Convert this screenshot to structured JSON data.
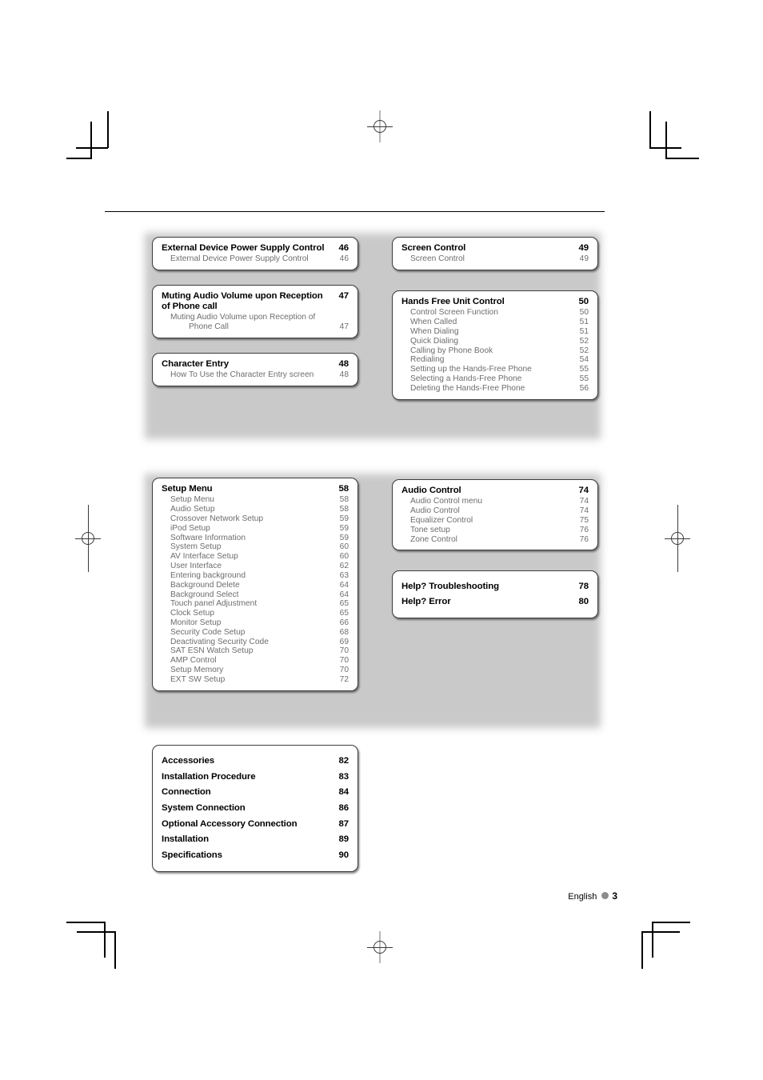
{
  "document": {
    "footer": {
      "language": "English",
      "page_number": "3"
    }
  },
  "groups": [
    {
      "id": "group-1",
      "columns": [
        {
          "id": "col-left-1",
          "boxes": [
            {
              "id": "external-device-power-supply-control",
              "title": "External Device Power Supply Control",
              "page": "46",
              "two_line_title": true,
              "items": [
                {
                  "label": "External Device Power Supply Control",
                  "page": "46"
                }
              ]
            },
            {
              "id": "muting-audio-volume",
              "title": "Muting Audio Volume upon Reception of Phone call",
              "page": "47",
              "two_line_title": true,
              "items": [
                {
                  "label": "Muting Audio Volume upon Reception of",
                  "continuation": "Phone Call",
                  "page": "47"
                }
              ]
            },
            {
              "id": "character-entry",
              "title": "Character Entry",
              "page": "48",
              "two_line_title": false,
              "items": [
                {
                  "label": "How To Use the Character Entry screen",
                  "page": "48"
                }
              ]
            }
          ]
        },
        {
          "id": "col-right-1",
          "boxes": [
            {
              "id": "screen-control",
              "title": "Screen Control",
              "page": "49",
              "two_line_title": false,
              "items": [
                {
                  "label": "Screen Control",
                  "page": "49"
                }
              ]
            },
            {
              "id": "hands-free-unit-control",
              "title": "Hands Free Unit Control",
              "page": "50",
              "two_line_title": false,
              "items": [
                {
                  "label": "Control Screen Function",
                  "page": "50"
                },
                {
                  "label": "When Called",
                  "page": "51"
                },
                {
                  "label": "When Dialing",
                  "page": "51"
                },
                {
                  "label": "Quick Dialing",
                  "page": "52"
                },
                {
                  "label": "Calling by Phone Book",
                  "page": "52"
                },
                {
                  "label": "Redialing",
                  "page": "54"
                },
                {
                  "label": "Setting up the Hands-Free Phone",
                  "page": "55"
                },
                {
                  "label": "Selecting a Hands-Free Phone",
                  "page": "55"
                },
                {
                  "label": "Deleting the Hands-Free Phone",
                  "page": "56"
                }
              ]
            }
          ]
        }
      ]
    },
    {
      "id": "group-2",
      "columns": [
        {
          "id": "col-left-2",
          "boxes": [
            {
              "id": "setup-menu",
              "title": "Setup Menu",
              "page": "58",
              "two_line_title": false,
              "items": [
                {
                  "label": "Setup Menu",
                  "page": "58"
                },
                {
                  "label": "Audio Setup",
                  "page": "58"
                },
                {
                  "label": "Crossover Network Setup",
                  "page": "59"
                },
                {
                  "label": "iPod Setup",
                  "page": "59"
                },
                {
                  "label": "Software Information",
                  "page": "59"
                },
                {
                  "label": "System Setup",
                  "page": "60"
                },
                {
                  "label": "AV Interface Setup",
                  "page": "60"
                },
                {
                  "label": "User Interface",
                  "page": "62"
                },
                {
                  "label": "Entering background",
                  "page": "63"
                },
                {
                  "label": "Background Delete",
                  "page": "64"
                },
                {
                  "label": "Background Select",
                  "page": "64"
                },
                {
                  "label": "Touch panel Adjustment",
                  "page": "65"
                },
                {
                  "label": "Clock Setup",
                  "page": "65"
                },
                {
                  "label": "Monitor Setup",
                  "page": "66"
                },
                {
                  "label": "Security Code Setup",
                  "page": "68"
                },
                {
                  "label": "Deactivating Security Code",
                  "page": "69"
                },
                {
                  "label": "SAT ESN Watch Setup",
                  "page": "70"
                },
                {
                  "label": "AMP Control",
                  "page": "70"
                },
                {
                  "label": "Setup Memory",
                  "page": "70"
                },
                {
                  "label": "EXT SW Setup",
                  "page": "72"
                }
              ]
            }
          ]
        },
        {
          "id": "col-right-2",
          "boxes": [
            {
              "id": "audio-control",
              "title": "Audio Control",
              "page": "74",
              "two_line_title": false,
              "items": [
                {
                  "label": "Audio Control menu",
                  "page": "74"
                },
                {
                  "label": "Audio Control",
                  "page": "74"
                },
                {
                  "label": "Equalizer Control",
                  "page": "75"
                },
                {
                  "label": "Tone setup",
                  "page": "76"
                },
                {
                  "label": "Zone Control",
                  "page": "76"
                }
              ]
            },
            {
              "id": "help-troubleshooting",
              "bold_only": true,
              "entries": [
                {
                  "label": "Help? Troubleshooting",
                  "page": "78"
                },
                {
                  "label": "Help? Error",
                  "page": "80"
                }
              ]
            }
          ]
        }
      ]
    },
    {
      "id": "group-3",
      "columns": [
        {
          "id": "col-left-3",
          "boxes": [
            {
              "id": "installation-reference",
              "bold_only": true,
              "entries": [
                {
                  "label": "Accessories",
                  "page": "82"
                },
                {
                  "label": "Installation Procedure",
                  "page": "83"
                },
                {
                  "label": "Connection",
                  "page": "84"
                },
                {
                  "label": "System Connection",
                  "page": "86"
                },
                {
                  "label": "Optional Accessory Connection",
                  "page": "87"
                },
                {
                  "label": "Installation",
                  "page": "89"
                },
                {
                  "label": "Specifications",
                  "page": "90"
                }
              ]
            }
          ]
        }
      ]
    }
  ]
}
